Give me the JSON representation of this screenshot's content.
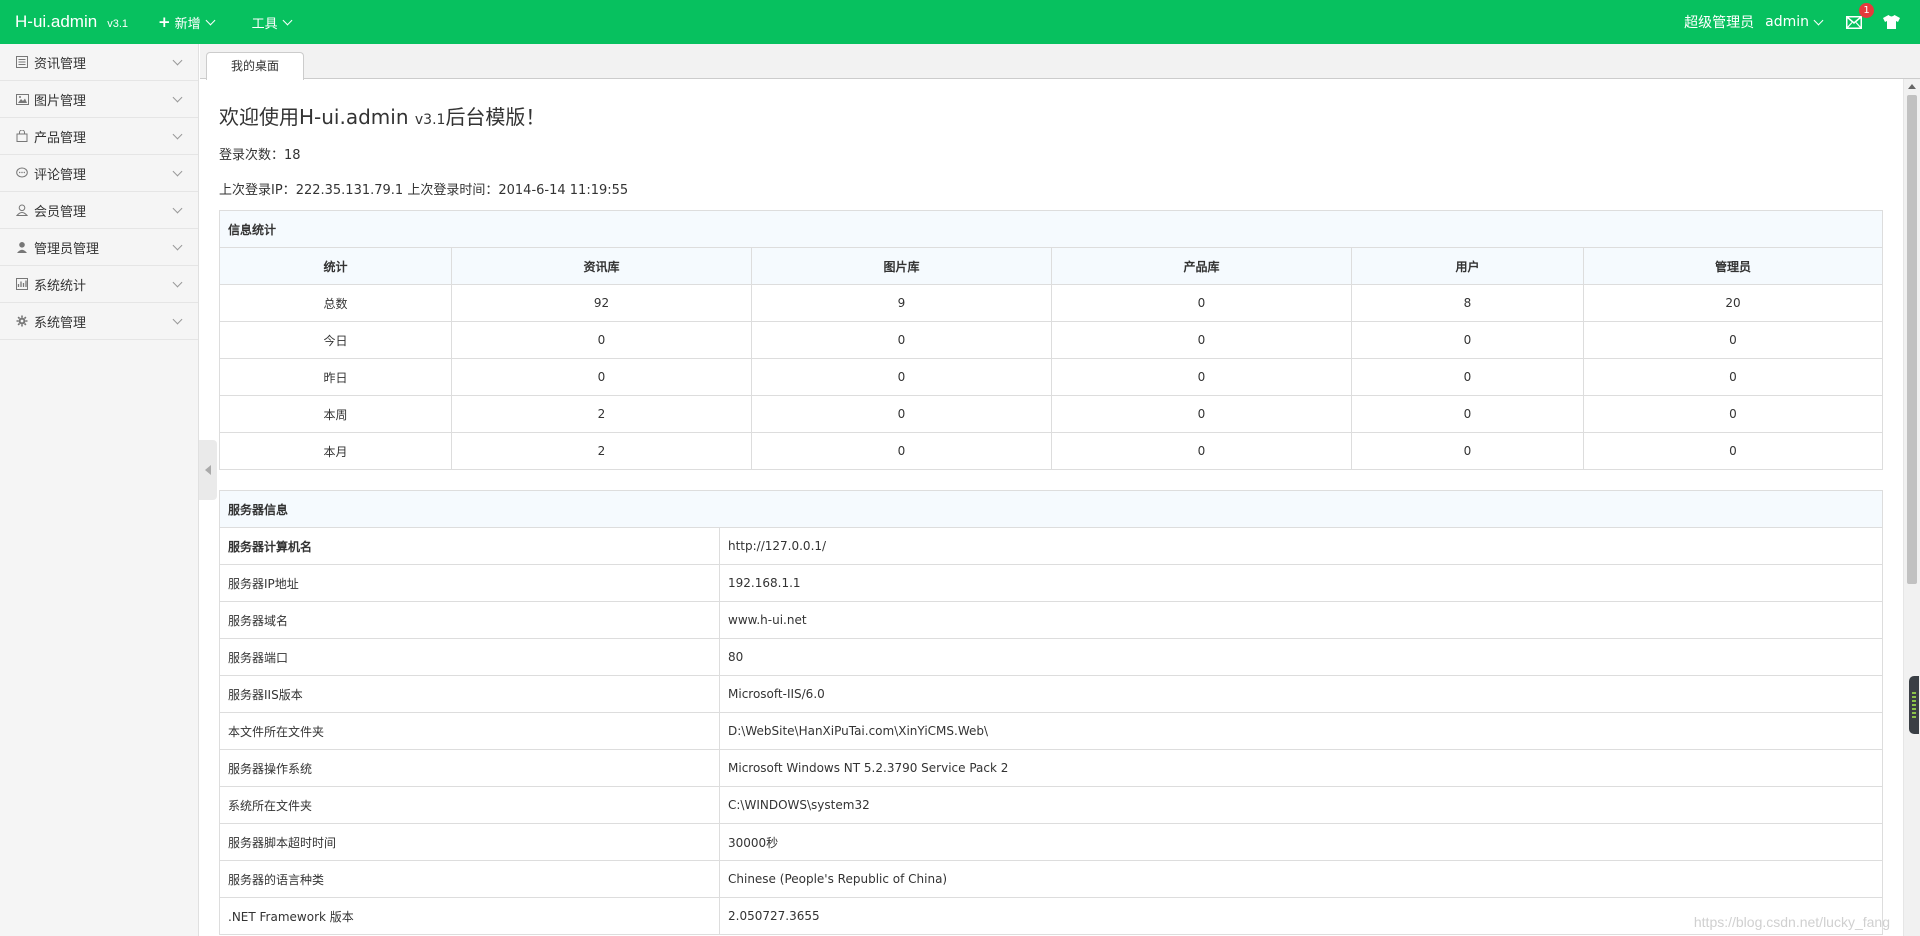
{
  "header": {
    "logo": "H-ui.admin",
    "version": "v3.1",
    "nav": [
      {
        "label": "新增",
        "plus": "+"
      },
      {
        "label": "工具"
      }
    ],
    "role": "超级管理员",
    "user": "admin",
    "message_count": "1",
    "accent": "#07c15f"
  },
  "sidebar": {
    "items": [
      {
        "label": "资讯管理",
        "icon": "news-icon"
      },
      {
        "label": "图片管理",
        "icon": "picture-icon"
      },
      {
        "label": "产品管理",
        "icon": "bag-icon"
      },
      {
        "label": "评论管理",
        "icon": "comment-icon"
      },
      {
        "label": "会员管理",
        "icon": "member-icon"
      },
      {
        "label": "管理员管理",
        "icon": "admin-icon"
      },
      {
        "label": "系统统计",
        "icon": "chart-icon"
      },
      {
        "label": "系统管理",
        "icon": "gear-icon"
      }
    ]
  },
  "tabs": [
    {
      "label": "我的桌面"
    }
  ],
  "main": {
    "welcome": "欢迎使用H-ui.admin",
    "welcome_version": "v3.1",
    "welcome_suffix": "后台模版！",
    "login_count_label": "登录次数：",
    "login_count": "18",
    "last_ip_label": "上次登录IP：",
    "last_ip": "222.35.131.79.1",
    "last_time_label": "上次登录时间：",
    "last_time": "2014-6-14 11:19:55"
  },
  "stats_table": {
    "caption": "信息统计",
    "headers": [
      "统计",
      "资讯库",
      "图片库",
      "产品库",
      "用户",
      "管理员"
    ],
    "rows": [
      [
        "总数",
        "92",
        "9",
        "0",
        "8",
        "20"
      ],
      [
        "今日",
        "0",
        "0",
        "0",
        "0",
        "0"
      ],
      [
        "昨日",
        "0",
        "0",
        "0",
        "0",
        "0"
      ],
      [
        "本周",
        "2",
        "0",
        "0",
        "0",
        "0"
      ],
      [
        "本月",
        "2",
        "0",
        "0",
        "0",
        "0"
      ]
    ]
  },
  "server_table": {
    "caption": "服务器信息",
    "rows": [
      [
        "服务器计算机名",
        "http://127.0.0.1/"
      ],
      [
        "服务器IP地址",
        "192.168.1.1"
      ],
      [
        "服务器域名",
        "www.h-ui.net"
      ],
      [
        "服务器端口",
        "80"
      ],
      [
        "服务器IIS版本",
        "Microsoft-IIS/6.0"
      ],
      [
        "本文件所在文件夹",
        "D:\\WebSite\\HanXiPuTai.com\\XinYiCMS.Web\\"
      ],
      [
        "服务器操作系统",
        "Microsoft Windows NT 5.2.3790 Service Pack 2"
      ],
      [
        "系统所在文件夹",
        "C:\\WINDOWS\\system32"
      ],
      [
        "服务器脚本超时时间",
        "30000秒"
      ],
      [
        "服务器的语言种类",
        "Chinese (People's Republic of China)"
      ],
      [
        ".NET Framework 版本",
        "2.050727.3655"
      ]
    ]
  },
  "watermark": "https://blog.csdn.net/lucky_fang"
}
